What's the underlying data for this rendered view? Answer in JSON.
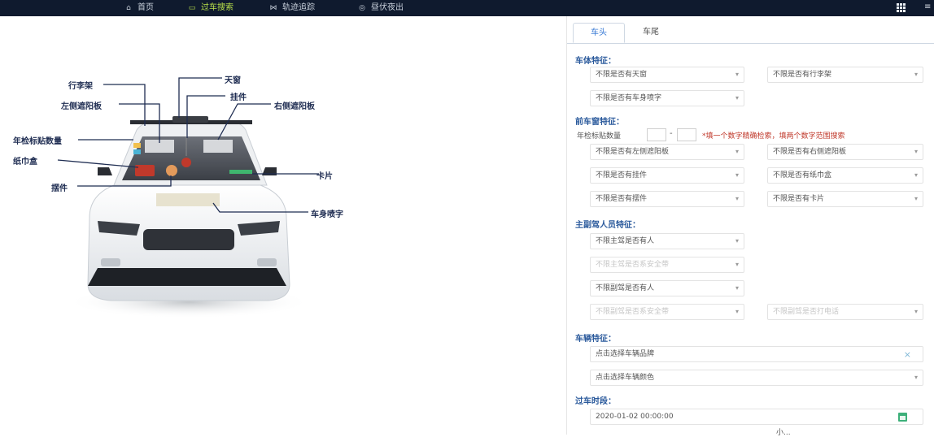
{
  "nav": {
    "items": [
      {
        "label": "首页",
        "icon": "home-icon",
        "glyph": "⌂",
        "active": false
      },
      {
        "label": "过车搜索",
        "icon": "monitor-icon",
        "glyph": "▭",
        "active": true
      },
      {
        "label": "轨迹追踪",
        "icon": "share-icon",
        "glyph": "⋈",
        "active": false
      },
      {
        "label": "昼伏夜出",
        "icon": "target-icon",
        "glyph": "◎",
        "active": false
      }
    ],
    "cut_text": "≡"
  },
  "annotations": {
    "luggage_rack": "行李架",
    "sunroof": "天窗",
    "left_visor": "左侧遮阳板",
    "pendant": "挂件",
    "right_visor": "右侧遮阳板",
    "inspection_sticker": "年检标贴数量",
    "tissue_box": "纸巾盒",
    "card": "卡片",
    "ornament": "摆件",
    "body_text": "车身喷字"
  },
  "panel": {
    "tabs": [
      {
        "label": "车头",
        "active": true
      },
      {
        "label": "车尾",
        "active": false
      }
    ],
    "sections": {
      "body": "车体特征：",
      "window": "前车窗特征：",
      "driver": "主副驾人员特征：",
      "vehicle": "车辆特征：",
      "time": "过车时段："
    },
    "selects": {
      "sunroof": "不限是否有天窗",
      "rack": "不限是否有行李架",
      "lettering": "不限是否有车身喷字",
      "left_visor": "不限是否有左侧遮阳板",
      "right_visor": "不限是否有右侧遮阳板",
      "pendant": "不限是否有挂件",
      "tissue": "不限是否有纸巾盒",
      "ornament": "不限是否有摆件",
      "card": "不限是否有卡片",
      "main_driver": "不限主驾是否有人",
      "main_belt": "不限主驾是否系安全带",
      "co_driver": "不限副驾是否有人",
      "co_belt": "不限副驾是否系安全带",
      "co_phone": "不限副驾是否打电话",
      "brand": "点击选择车辆品牌",
      "color": "点击选择车辆颜色"
    },
    "sticker_label": "年检标贴数量",
    "sticker_hint": "*填一个数字精确检索，填两个数字范围搜索",
    "datetime": "2020-01-02 00:00:00"
  },
  "watermark": "小...",
  "colors": {
    "nav_bg": "#0f1a2e",
    "nav_active": "#b8e04a",
    "section": "#2b5a9c",
    "annotation": "#1f2d52",
    "hint": "#c0392b"
  }
}
